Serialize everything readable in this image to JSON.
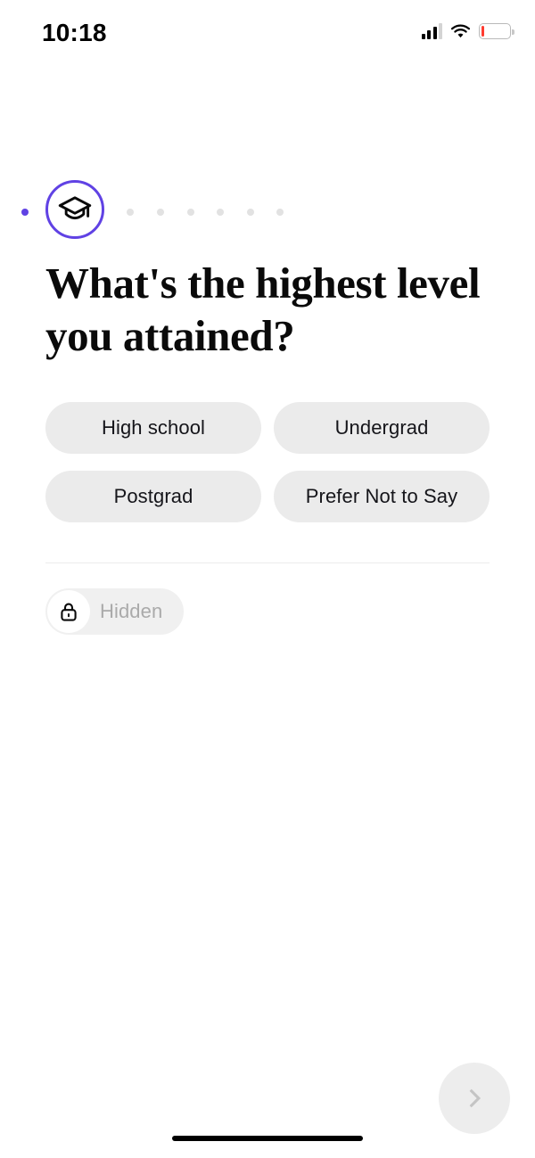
{
  "status_bar": {
    "time": "10:18",
    "signal_icon": "cellular-signal-icon",
    "signal_bars_total": 4,
    "signal_bars_filled": 3,
    "wifi_icon": "wifi-icon",
    "battery_icon": "battery-low-icon",
    "battery_level_percent": 11,
    "battery_color": "#ff3b30"
  },
  "progress": {
    "current_step_icon": "graduation-cap-icon",
    "active_color": "#6042e4",
    "inactive_color": "#e2e2e2",
    "leading_dot_active": true,
    "trailing_dots": 6
  },
  "question": {
    "title": "What's the highest level you attained?"
  },
  "options": [
    {
      "label": "High school"
    },
    {
      "label": "Undergrad"
    },
    {
      "label": "Postgrad"
    },
    {
      "label": "Prefer Not to Say"
    }
  ],
  "privacy": {
    "lock_icon": "lock-icon",
    "label": "Hidden"
  },
  "footer": {
    "next_icon": "chevron-right-icon",
    "next_enabled": false,
    "home_indicator": "home-indicator"
  }
}
